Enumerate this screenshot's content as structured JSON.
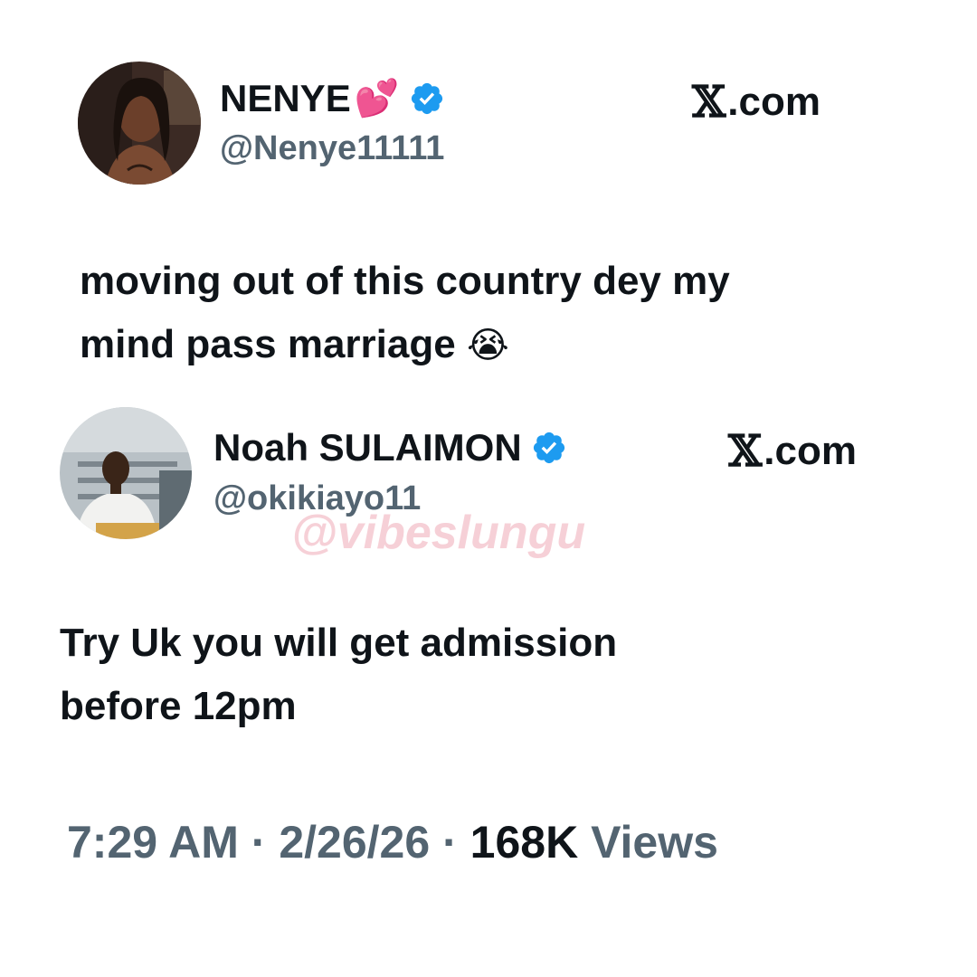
{
  "tweet1": {
    "display_name": "NENYE",
    "name_emoji": "💕",
    "handle": "@Nenye11111",
    "source_label": ".com",
    "source_glyph": "𝕏",
    "text_line1": "moving out of this country dey my",
    "text_line2": "mind pass marriage",
    "text_emoji": "😭"
  },
  "tweet2": {
    "display_name": "Noah SULAIMON",
    "handle": "@okikiayo11",
    "source_label": ".com",
    "source_glyph": "𝕏",
    "text_line1": "Try Uk you will get admission",
    "text_line2": "before 12pm"
  },
  "watermark": "@vibeslungu",
  "meta": {
    "time": "7:29 AM",
    "separator": "·",
    "date": "2/26/26",
    "views_count": "168K",
    "views_label": "Views"
  },
  "colors": {
    "verified": "#1d9bf0",
    "secondary_text": "#536471",
    "primary_text": "#0f1419"
  },
  "icons": {
    "verified": "verified-badge-icon",
    "x_logo": "x-logo-icon"
  }
}
